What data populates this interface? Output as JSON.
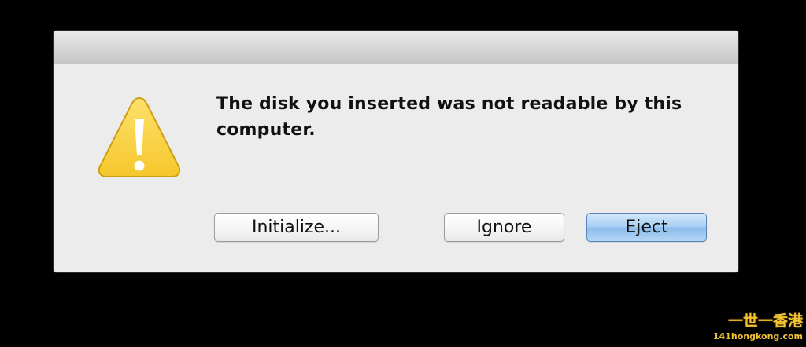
{
  "dialog": {
    "message": "The disk you inserted was not readable by this computer.",
    "icon": "warning-triangle-icon",
    "buttons": {
      "initialize": "Initialize...",
      "ignore": "Ignore",
      "eject": "Eject"
    }
  },
  "watermark": {
    "cjk": "一世一香港",
    "url": "141hongkong.com"
  },
  "colors": {
    "background": "#000000",
    "dialog": "#ececec",
    "warning_yellow": "#f8cf35",
    "default_button": "#a7cff3",
    "watermark": "#f1c232"
  }
}
